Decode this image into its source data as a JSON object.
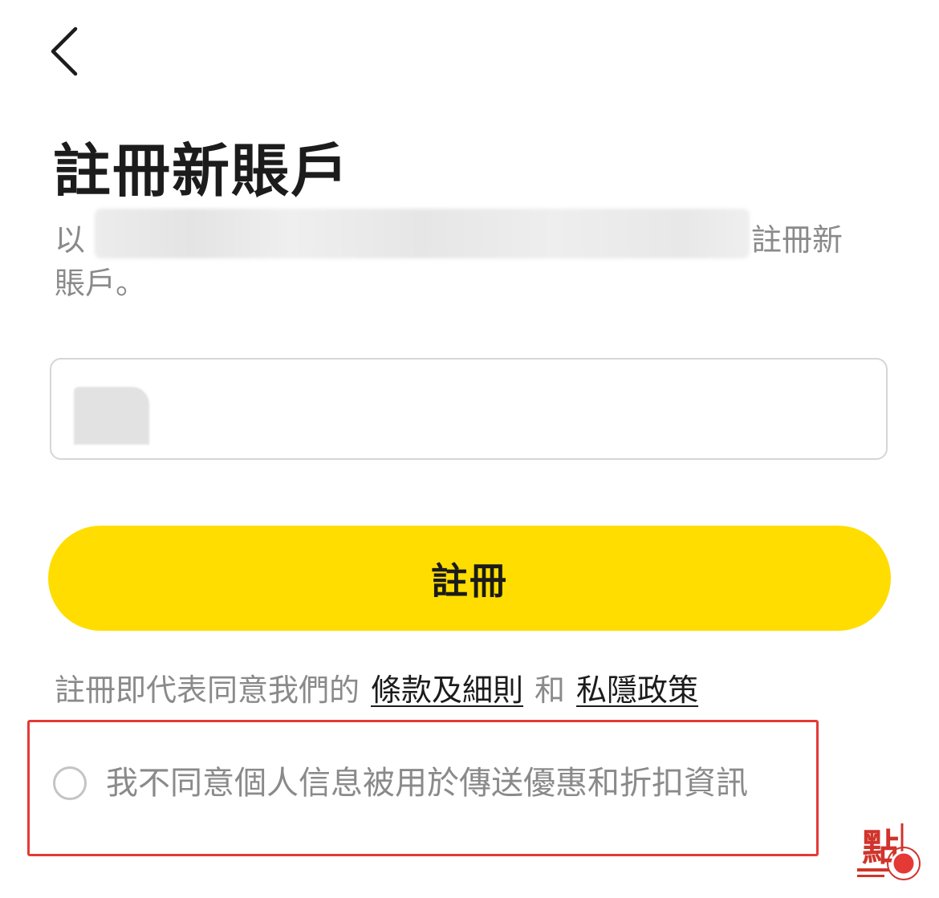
{
  "header": {
    "back_icon": "chevron-left-icon"
  },
  "page": {
    "title": "註冊新賬戶",
    "subtitle_prefix": "以",
    "subtitle_suffix": "註冊新",
    "subtitle_line2": "賬戶。"
  },
  "form": {
    "input_value": "",
    "register_label": "註冊"
  },
  "terms": {
    "prefix": "註冊即代表同意我們的",
    "terms_link": "條款及細則",
    "conjunction": "和",
    "privacy_link": "私隱政策"
  },
  "consent": {
    "label": "我不同意個人信息被用於傳送優惠和折扣資訊",
    "checked": false
  },
  "colors": {
    "accent": "#ffdd00",
    "highlight_border": "#e53935",
    "muted_text": "#8a8a8a"
  },
  "watermark": {
    "text": "點"
  }
}
